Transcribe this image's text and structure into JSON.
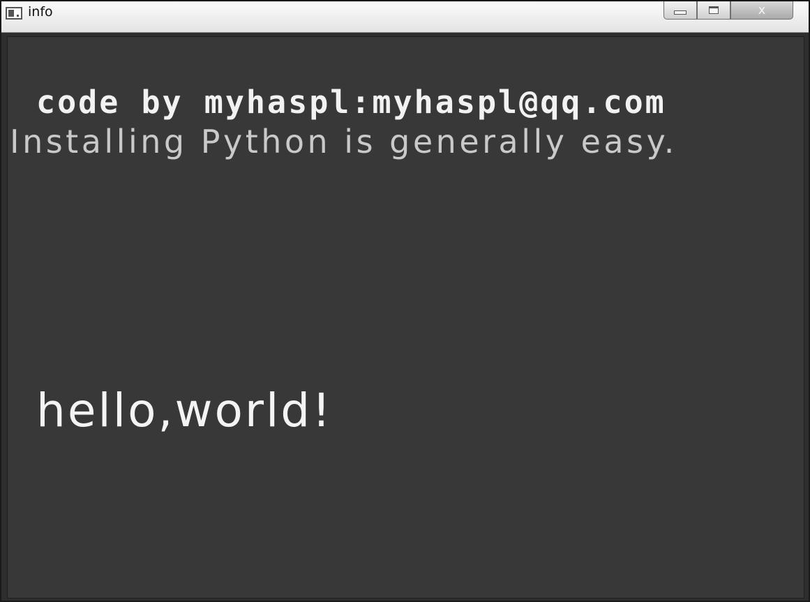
{
  "window": {
    "title": "info",
    "controls": {
      "minimize_icon": "minimize-icon",
      "maximize_icon": "maximize-icon",
      "close_symbol": "x"
    }
  },
  "canvas": {
    "background_color": "#383838",
    "lines": {
      "credit": "code by myhaspl:myhaspl@qq.com",
      "info": "Installing Python is generally easy.",
      "hello": "hello,world!"
    }
  }
}
